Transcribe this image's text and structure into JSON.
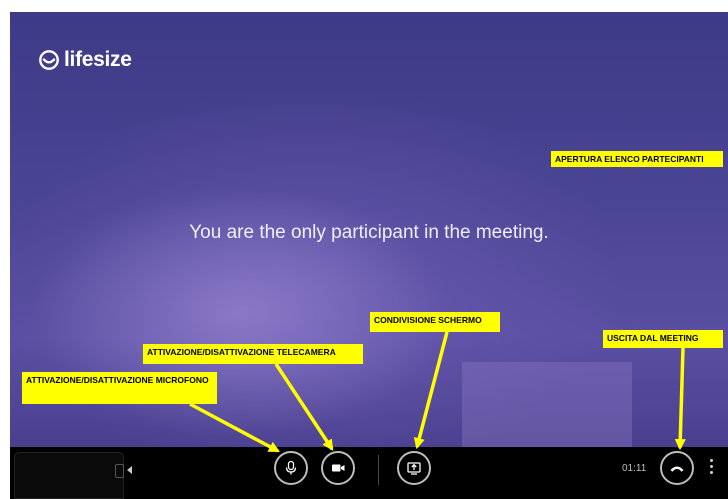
{
  "app": {
    "brand": "lifesize",
    "message": "You are the only participant in the meeting."
  },
  "toolbar": {
    "timer": "01:11",
    "icons": {
      "mic": "microphone-icon",
      "camera": "video-camera-icon",
      "share": "screen-share-icon",
      "hangup": "hang-up-icon",
      "more": "more-vertical-icon",
      "collapse": "caret-left-icon"
    }
  },
  "annotations": {
    "participants": "APERTURA ELENCO PARTECIPANTI",
    "share": "CONDIVISIONE SCHERMO",
    "camera": "ATTIVAZIONE/DISATTIVAZIONE TELECAMERA",
    "exit": "USCITA DAL MEETING",
    "mic": "ATTIVAZIONE/DISATTIVAZIONE MICROFONO"
  },
  "colors": {
    "background": "#4b4595",
    "toolbar": "#000000",
    "callout": "#ffff00",
    "arrow": "#ffff00"
  }
}
